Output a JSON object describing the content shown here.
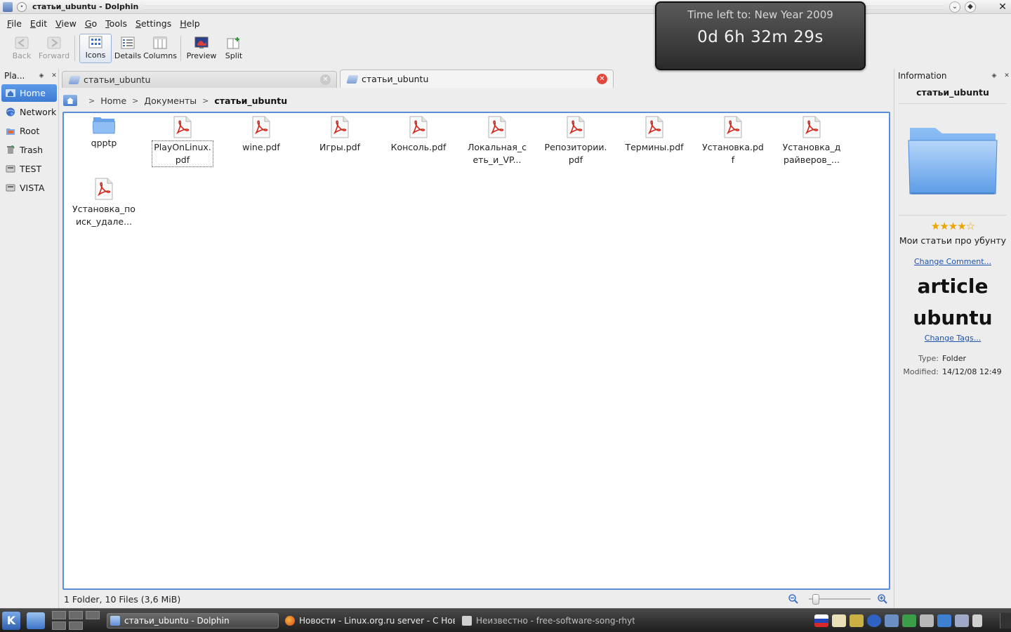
{
  "window": {
    "title": "статьи_ubuntu - Dolphin",
    "menu_icon": "dot-icon",
    "btn_minimize": "⌄",
    "btn_maximize": "◆",
    "btn_close": "✕"
  },
  "menubar": [
    {
      "label": "File",
      "accel": "F",
      "rest": "ile"
    },
    {
      "label": "Edit",
      "accel": "E",
      "rest": "dit"
    },
    {
      "label": "View",
      "accel": "V",
      "rest": "iew"
    },
    {
      "label": "Go",
      "accel": "G",
      "rest": "o"
    },
    {
      "label": "Tools",
      "accel": "T",
      "rest": "ools"
    },
    {
      "label": "Settings",
      "accel": "S",
      "rest": "ettings"
    },
    {
      "label": "Help",
      "accel": "H",
      "rest": "elp"
    }
  ],
  "toolbar": {
    "back": "Back",
    "forward": "Forward",
    "icons": "Icons",
    "details": "Details",
    "columns": "Columns",
    "preview": "Preview",
    "split": "Split"
  },
  "countdown": {
    "label": "Time left to: New Year 2009",
    "value": "0d 6h 32m 29s"
  },
  "places": {
    "title": "Pla...",
    "items": [
      {
        "label": "Home",
        "icon": "home-icon",
        "selected": true
      },
      {
        "label": "Network",
        "icon": "network-icon"
      },
      {
        "label": "Root",
        "icon": "root-folder-icon"
      },
      {
        "label": "Trash",
        "icon": "trash-icon"
      },
      {
        "label": "TEST",
        "icon": "drive-icon"
      },
      {
        "label": "VISTA",
        "icon": "drive-icon"
      }
    ]
  },
  "tabs": [
    {
      "label": "статьи_ubuntu",
      "active": false
    },
    {
      "label": "статьи_ubuntu",
      "active": true
    }
  ],
  "breadcrumb": {
    "home": "Home",
    "docs": "Документы",
    "current": "статьи_ubuntu",
    "sep": ">"
  },
  "files": [
    {
      "name": "qpptp",
      "type": "folder"
    },
    {
      "name": "PlayOnLinux.\npdf",
      "type": "pdf",
      "focused": true
    },
    {
      "name": "wine.pdf",
      "type": "pdf"
    },
    {
      "name": "Игры.pdf",
      "type": "pdf"
    },
    {
      "name": "Консоль.pdf",
      "type": "pdf"
    },
    {
      "name": "Локальная_с\nеть_и_VP...",
      "type": "pdf"
    },
    {
      "name": "Репозитории.\npdf",
      "type": "pdf"
    },
    {
      "name": "Термины.pdf",
      "type": "pdf"
    },
    {
      "name": "Установка.pd\nf",
      "type": "pdf"
    },
    {
      "name": "Установка_д\nрайверов_...",
      "type": "pdf"
    },
    {
      "name": "Установка_по\nиск_удале...",
      "type": "pdf"
    }
  ],
  "statusbar": {
    "summary": "1 Folder, 10 Files (3,6 MiB)",
    "zoom_out_icon": "zoom-out-icon",
    "zoom_in_icon": "zoom-in-icon",
    "zoom_level": 0.06
  },
  "info": {
    "title": "Information",
    "name": "статьи_ubuntu",
    "rating_stars": "★★★★☆",
    "rating": 4,
    "comment": "Мои статьи про убунту",
    "change_comment": "Change Comment...",
    "tag1": "article",
    "tag2": "ubuntu",
    "change_tags": "Change Tags...",
    "type_key": "Type:",
    "type_val": "Folder",
    "modified_key": "Modified:",
    "modified_val": "14/12/08 12:49"
  },
  "taskbar": {
    "kmenu": "K",
    "tasks": [
      {
        "label": "статьи_ubuntu - Dolphin",
        "active": true
      },
      {
        "label": "Новости - Linux.org.ru server - С Новым",
        "active": false
      },
      {
        "label": "Неизвестно - free-software-song-rhythm",
        "active": false
      }
    ],
    "colors": {
      "accent": "#3e7bd3",
      "selection_border": "#5a8fd8",
      "close_red": "#e2473b"
    }
  }
}
